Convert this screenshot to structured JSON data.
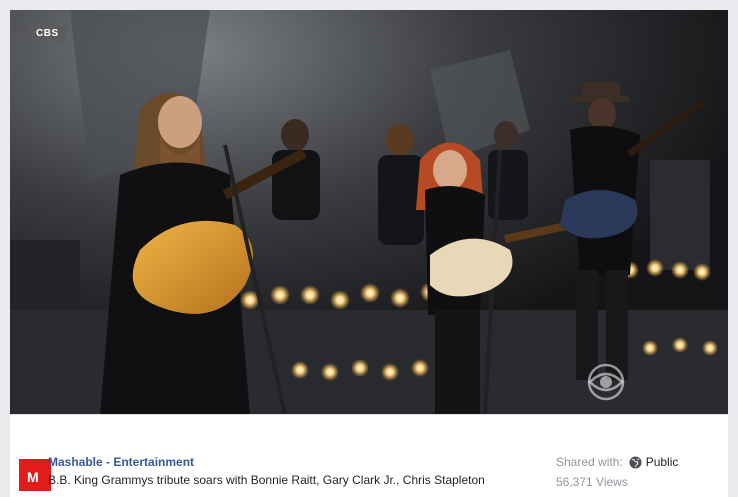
{
  "video": {
    "network_tag": "CBS",
    "description": "Performance still: bearded guitarist with hat-less long hair, red-haired guitarist, hatted guitarist, band with string players, stage lights",
    "watermark_icon": "cbs-eye-icon"
  },
  "footer": {
    "page_name": "Mashable - Entertainment",
    "logo_letter": "M",
    "title": "B.B. King Grammys tribute soars with Bonnie Raitt, Gary Clark Jr., Chris Stapleton",
    "shared_label": "Shared with:",
    "privacy": "Public",
    "privacy_icon": "globe-icon",
    "views": "56,371 Views"
  },
  "colors": {
    "brand_red": "#e21b1b",
    "link_blue": "#365899",
    "muted": "#90949c"
  }
}
